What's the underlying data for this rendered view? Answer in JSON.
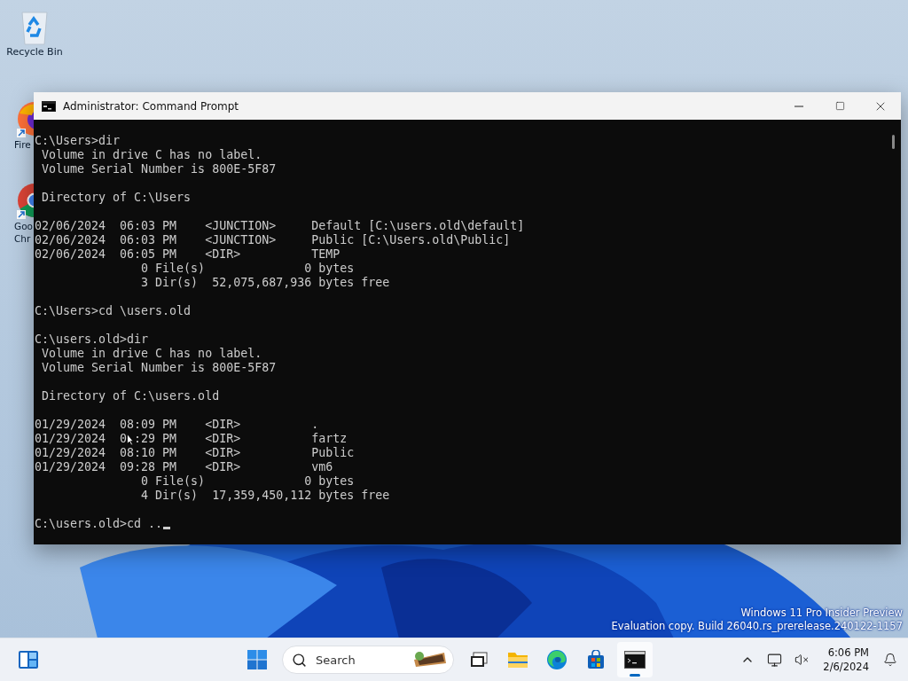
{
  "desktop": {
    "icons": [
      {
        "kind": "recycle",
        "label_lines": [
          "Recycle Bin"
        ]
      },
      {
        "kind": "firefox",
        "label_lines": [
          "Fire"
        ]
      },
      {
        "kind": "chrome",
        "label_lines": [
          "Goo",
          "Chr"
        ]
      }
    ]
  },
  "window": {
    "title": "Administrator: Command Prompt",
    "console": {
      "blocks": [
        [
          "C:\\Users>dir",
          " Volume in drive C has no label.",
          " Volume Serial Number is 800E-5F87"
        ],
        [
          " Directory of C:\\Users"
        ],
        [
          "02/06/2024  06:03 PM    <JUNCTION>     Default [C:\\users.old\\default]",
          "02/06/2024  06:03 PM    <JUNCTION>     Public [C:\\Users.old\\Public]",
          "02/06/2024  06:05 PM    <DIR>          TEMP",
          "               0 File(s)              0 bytes",
          "               3 Dir(s)  52,075,687,936 bytes free"
        ],
        [
          "C:\\Users>cd \\users.old"
        ],
        [
          "C:\\users.old>dir",
          " Volume in drive C has no label.",
          " Volume Serial Number is 800E-5F87"
        ],
        [
          " Directory of C:\\users.old"
        ],
        [
          "01/29/2024  08:09 PM    <DIR>          .",
          [
            "01/29/2024  0",
            ":29 PM    <DIR>          fartz"
          ],
          "01/29/2024  08:10 PM    <DIR>          Public",
          "01/29/2024  09:28 PM    <DIR>          vm6",
          "               0 File(s)              0 bytes",
          "               4 Dir(s)  17,359,450,112 bytes free"
        ],
        [
          "C:\\users.old>cd .."
        ]
      ]
    }
  },
  "watermark": [
    "Windows 11 Pro Insider Preview",
    "Evaluation copy. Build 26040.rs_prerelease.240122-1157"
  ],
  "taskbar": {
    "search": {
      "placeholder": "Search"
    },
    "apps": [
      {
        "kind": "taskview",
        "active": false
      },
      {
        "kind": "explorer",
        "active": false
      },
      {
        "kind": "edge",
        "active": false
      },
      {
        "kind": "store",
        "active": false
      },
      {
        "kind": "terminal",
        "active": true
      }
    ],
    "clock": {
      "time": "6:06 PM",
      "date": "2/6/2024"
    }
  }
}
